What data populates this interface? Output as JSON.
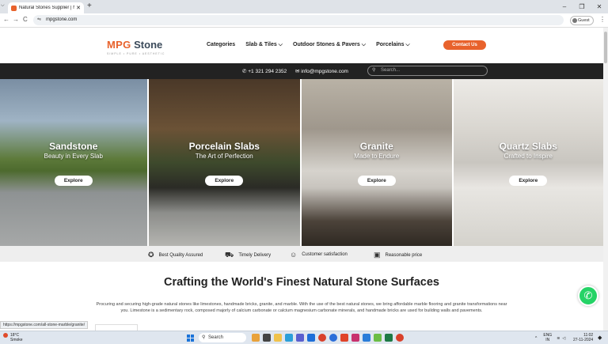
{
  "browser": {
    "tab_title": "Natural Stones Supplier | Natu",
    "tab_close": "✕",
    "new_tab": "+",
    "url": "mpgstone.com",
    "guest_label": "Guest",
    "back": "←",
    "forward": "→",
    "reload": "C",
    "minimize": "–",
    "maximize": "❐",
    "close": "✕",
    "menu": "⋮"
  },
  "header": {
    "logo_mpg": "MPG",
    "logo_stone": " Stone",
    "logo_tagline": "SIMPLE • PURE • AESTHETIC",
    "nav": [
      "Categories",
      "Slab & Tiles ⌵",
      "Outdoor Stones & Pavers ⌵",
      "Porcelains ⌵"
    ],
    "contact_label": "Contact Us"
  },
  "infobar": {
    "phone": "+1 321 294 2352",
    "email": "info@mpgstone.com",
    "search_placeholder": "Search..."
  },
  "hero": [
    {
      "title": "Sandstone",
      "subtitle": "Beauty in Every Slab",
      "button": "Explore"
    },
    {
      "title": "Porcelain Slabs",
      "subtitle": "The Art of Perfection",
      "button": "Explore"
    },
    {
      "title": "Granite",
      "subtitle": "Made to Endure",
      "button": "Explore"
    },
    {
      "title": "Quartz Slabs",
      "subtitle": "Crafted to Inspire",
      "button": "Explore"
    }
  ],
  "features": [
    {
      "label": "Best Quality Assured",
      "icon": "badge-icon"
    },
    {
      "label": "Timely Delivery",
      "icon": "truck-icon"
    },
    {
      "label": "Customer satisfaction",
      "icon": "handshake-icon"
    },
    {
      "label": "Reasonable price",
      "icon": "wallet-icon"
    }
  ],
  "main": {
    "headline": "Crafting the World's Finest Natural Stone Surfaces",
    "paragraph": "Procuring and securing high-grade natural stones like limestones, handmade bricks, granite, and marble. With the use of the best natural stones, we bring affordable marble flooring and granite transformations near you. Limestone is a sedimentary rock, composed majorly of calcium carbonate or calcium magnesium carbonate minerals, and handmade bricks are used for building walls and pavements."
  },
  "status_url": "https://mpgstone.com/all-stone-marble/granite/",
  "taskbar": {
    "weather_temp": "18°C",
    "weather_desc": "Smoke",
    "search_label": "Search",
    "lang_top": "ENG",
    "lang_bottom": "IN",
    "time": "11:02",
    "date": "27-11-2024"
  },
  "colors": {
    "brand_orange": "#e8622c",
    "infobar_bg": "#222222",
    "whatsapp": "#25d366"
  }
}
